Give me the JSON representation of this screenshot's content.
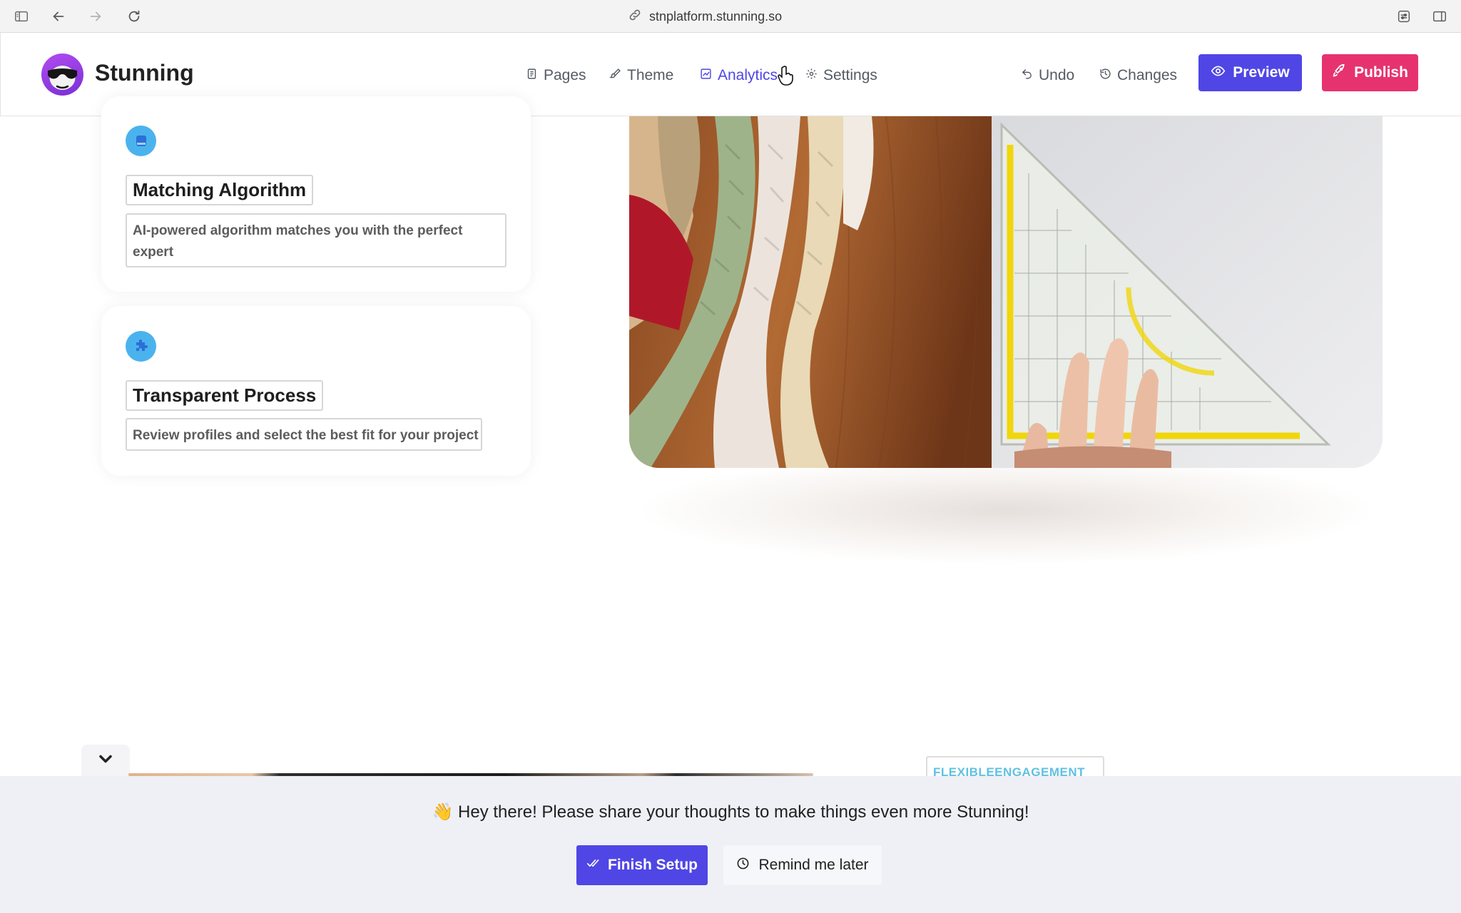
{
  "browser": {
    "url": "stnplatform.stunning.so"
  },
  "header": {
    "brand": "Stunning",
    "nav": [
      {
        "label": "Pages",
        "icon": "page-icon"
      },
      {
        "label": "Theme",
        "icon": "brush-icon"
      },
      {
        "label": "Analytics",
        "icon": "chart-icon",
        "active": true
      },
      {
        "label": "Settings",
        "icon": "gear-icon"
      }
    ],
    "undo_label": "Undo",
    "changes_label": "Changes",
    "preview_label": "Preview",
    "publish_label": "Publish",
    "colors": {
      "primary": "#4f46e5",
      "publish": "#e6336f"
    }
  },
  "features": [
    {
      "title": "Matching Algorithm",
      "description": "AI-powered algorithm matches you with the perfect expert",
      "icon": "database-icon"
    },
    {
      "title": "Transparent Process",
      "description": "Review profiles and select the best fit for your project",
      "icon": "puzzle-icon"
    }
  ],
  "next_section": {
    "tag": "FLEXIBLEENGAGEMENT"
  },
  "banner": {
    "message": "👋 Hey there! Please share your thoughts to make things even more Stunning!",
    "finish_label": "Finish Setup",
    "remind_label": "Remind me later"
  }
}
